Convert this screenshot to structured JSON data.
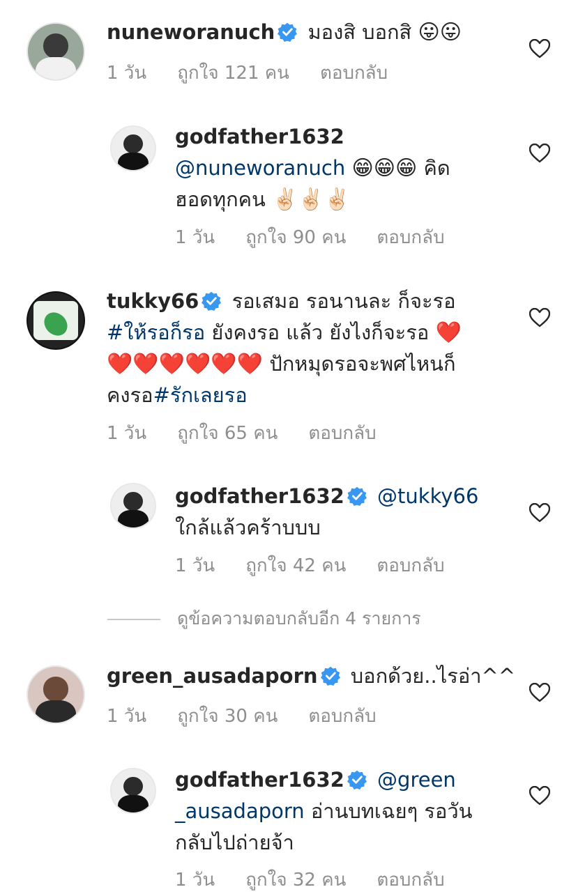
{
  "comments": [
    {
      "username": "nuneworanuch",
      "verified": true,
      "text": "มองสิ บอกสิ",
      "emoji": "😛😛",
      "time": "1 วัน",
      "likes": "ถูกใจ 121 คน",
      "reply": "ตอบกลับ"
    },
    {
      "username": "godfather1632",
      "verified": false,
      "mention": "@nuneworanuch",
      "emoji1": "😁😁😁",
      "text1": "คิด",
      "text2": "ฮอดทุกคน",
      "emoji2": "✌🏻✌🏻✌🏻",
      "time": "1 วัน",
      "likes": "ถูกใจ 90 คน",
      "reply": "ตอบกลับ"
    },
    {
      "username": "tukky66",
      "verified": true,
      "text1": "รอเสมอ รอนานละ ก็จะรอ",
      "hashtag1": "#ให้รอก็รอ",
      "text2": "ยังคงรอ แล้ว ยังไงก็จะรอ",
      "hearts1": "❤️",
      "hearts2": "❤️❤️❤️❤️❤️❤️",
      "text3": "ปักหมุดรอจะพศไหนก็",
      "text4": "คงรอ",
      "hashtag2": "#รักเลยรอ",
      "time": "1 วัน",
      "likes": "ถูกใจ 65 คน",
      "reply": "ตอบกลับ"
    },
    {
      "username": "godfather1632",
      "verified": true,
      "mention": "@tukky66",
      "text": "ใกล้แล้วคร้าบบบ",
      "time": "1 วัน",
      "likes": "ถูกใจ 42 คน",
      "reply": "ตอบกลับ"
    },
    {
      "username": "green_ausadaporn",
      "verified": true,
      "text": "บอกด้วย..ไรอ่า^^",
      "time": "1 วัน",
      "likes": "ถูกใจ 30 คน",
      "reply": "ตอบกลับ"
    },
    {
      "username": "godfather1632",
      "verified": true,
      "mention1": "@green",
      "mention2": "_ausadaporn",
      "text1": "อ่านบทเฉยๆ รอวัน",
      "text2": "กลับไปถ่ายจ้า",
      "time": "1 วัน",
      "likes": "ถูกใจ 32 คน",
      "reply": "ตอบกลับ"
    }
  ],
  "view_more_replies": "ดูข้อความตอบกลับอีก 4 รายการ",
  "colors": {
    "verified": "#3897f0",
    "link": "#00376b",
    "meta": "#8e8e8e"
  }
}
